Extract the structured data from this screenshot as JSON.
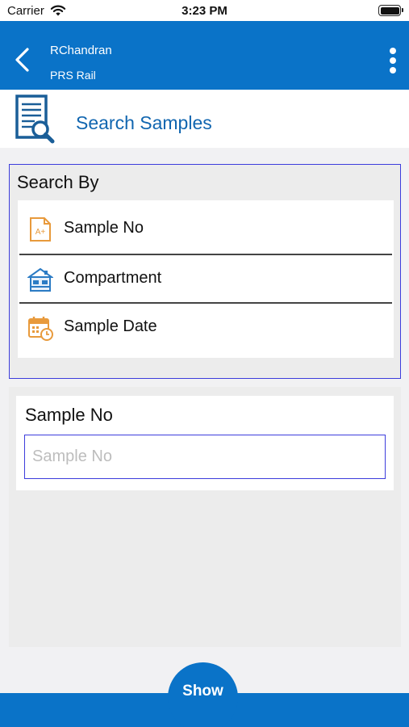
{
  "status_bar": {
    "carrier": "Carrier",
    "time": "3:23 PM"
  },
  "header": {
    "user_name": "RChandran",
    "subtitle": "PRS Rail"
  },
  "page": {
    "title": "Search Samples"
  },
  "search_by": {
    "heading": "Search By",
    "options": [
      {
        "label": "Sample No",
        "icon": "grade-doc-icon"
      },
      {
        "label": "Compartment",
        "icon": "compartment-icon"
      },
      {
        "label": "Sample Date",
        "icon": "calendar-clock-icon"
      }
    ]
  },
  "sample_no": {
    "label": "Sample No",
    "value": "",
    "placeholder": "Sample No"
  },
  "actions": {
    "show_label": "Show"
  },
  "colors": {
    "primary": "#0a73c8",
    "title": "#1166b0",
    "accent_border": "#3d3ddc",
    "icon_orange": "#e89a3c",
    "icon_blue": "#2b7bc4"
  }
}
